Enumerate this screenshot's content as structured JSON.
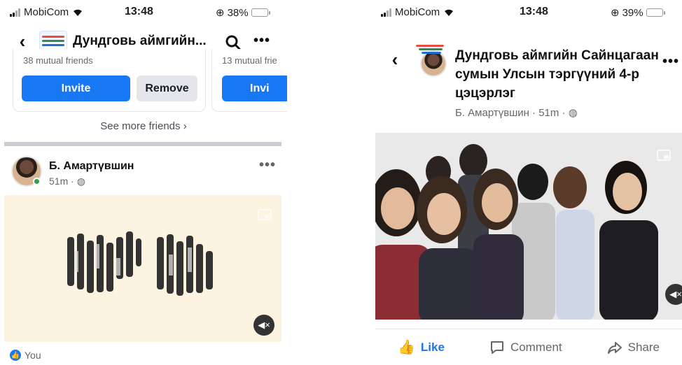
{
  "left": {
    "status": {
      "carrier": "MobiCom",
      "time": "13:48",
      "battery": "38%",
      "battery_level": 0.38
    },
    "header": {
      "title": "Дундговь аймгийн...",
      "back_icon": "chevron-left-icon",
      "search_icon": "search-icon",
      "more_icon": "more-icon"
    },
    "friend_cards": [
      {
        "mutual": "38 mutual friends",
        "invite": "Invite",
        "remove": "Remove"
      },
      {
        "mutual": "13 mutual frie",
        "invite": "Invi"
      }
    ],
    "see_more": "See more friends",
    "post": {
      "author": "Б. Амартүвшин",
      "meta": "51m ·"
    },
    "reaction": {
      "text": "You"
    }
  },
  "right": {
    "status": {
      "carrier": "MobiCom",
      "time": "13:48",
      "battery": "39%",
      "battery_level": 0.39
    },
    "header": {
      "title": "Дундговь аймгийн Сайнцагаан сумын Улсын тэргүүний 4-р цэцэрлэг",
      "author_meta": "Б. Амартүвшин · 51m ·"
    },
    "actions": {
      "like": "Like",
      "comment": "Comment",
      "share": "Share"
    }
  },
  "colors": {
    "accent": "#1877f2",
    "online": "#31a24c",
    "battery": "#f6c30a"
  }
}
